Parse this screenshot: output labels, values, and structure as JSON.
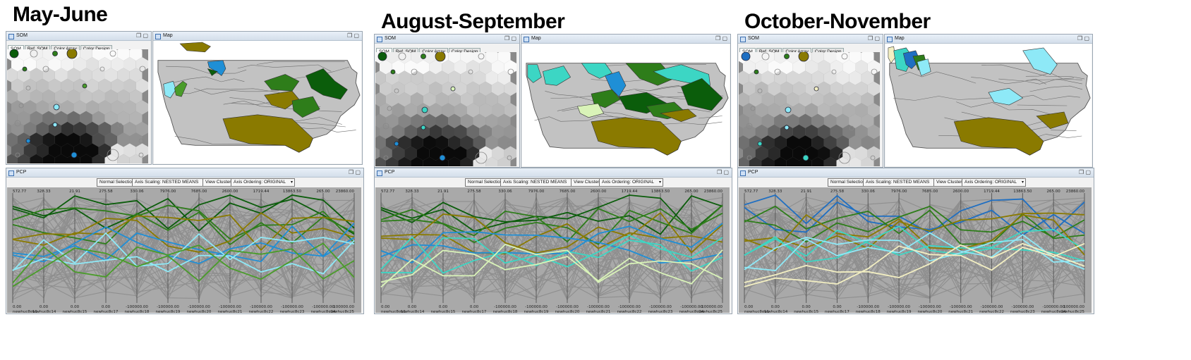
{
  "panels": [
    {
      "title": "May-June",
      "som_window": {
        "title": "SOM",
        "tabs": [
          "SOM",
          "Ref. SOM",
          "Color Array",
          "Color Design"
        ]
      },
      "map_window": {
        "title": "Map"
      },
      "pcp_window": {
        "title": "PCP",
        "controls": [
          "Normal Selection",
          "Axis Scaling: NESTED MEANS",
          "View Clusters",
          "Axis Ordering: ORIGINAL"
        ],
        "axis_labels": [
          "newhuc8c11",
          "newhuc8c14",
          "newhuc8c15",
          "newhuc8c17",
          "newhuc8c18",
          "newhuc8c19",
          "newhuc8c20",
          "newhuc8c21",
          "newhuc8c22",
          "newhuc8c23",
          "newhuc8c24",
          "newhuc8c25"
        ],
        "top_values": [
          "572.77",
          "328.33",
          "21.91",
          "275.58",
          "330.06",
          "7976.00",
          "7685.00",
          "2600.00",
          "1719.44",
          "13863.50",
          "265.00",
          "23860.00"
        ],
        "bottom_values": [
          "0.00",
          "0.00",
          "0.00",
          "0.00",
          "-100000.00",
          "-100000.00",
          "-100000.00",
          "-100000.00",
          "-100000.00",
          "-100000.00",
          "-100000.00",
          "-100000.00"
        ]
      }
    },
    {
      "title": "August-September",
      "som_window": {
        "title": "SOM",
        "tabs": [
          "SOM",
          "Ref. SOM",
          "Color Array",
          "Color Design"
        ]
      },
      "map_window": {
        "title": "Map"
      },
      "pcp_window": {
        "title": "PCP",
        "controls": [
          "Normal Selection",
          "Axis Scaling: NESTED MEANS",
          "View Clusters",
          "Axis Ordering: ORIGINAL"
        ],
        "axis_labels": [
          "newhuc8c11",
          "newhuc8c14",
          "newhuc8c15",
          "newhuc8c17",
          "newhuc8c18",
          "newhuc8c19",
          "newhuc8c20",
          "newhuc8c21",
          "newhuc8c22",
          "newhuc8c23",
          "newhuc8c24",
          "newhuc8c25"
        ],
        "top_values": [
          "572.77",
          "328.33",
          "21.91",
          "275.58",
          "330.06",
          "7976.00",
          "7685.00",
          "2600.00",
          "1719.44",
          "13863.50",
          "265.00",
          "23860.00"
        ],
        "bottom_values": [
          "0.00",
          "0.00",
          "0.00",
          "0.00",
          "-100000.00",
          "-100000.00",
          "-100000.00",
          "-100000.00",
          "-100000.00",
          "-100000.00",
          "-100000.00",
          "-100000.00"
        ]
      }
    },
    {
      "title": "October-November",
      "som_window": {
        "title": "SOM",
        "tabs": [
          "SOM",
          "Ref. SOM",
          "Color Array",
          "Color Design"
        ]
      },
      "map_window": {
        "title": "Map"
      },
      "pcp_window": {
        "title": "PCP",
        "controls": [
          "Normal Selection",
          "Axis Scaling: NESTED MEANS",
          "View Clusters",
          "Axis Ordering: ORIGINAL"
        ],
        "axis_labels": [
          "newhuc8c11",
          "newhuc8c14",
          "newhuc8c15",
          "newhuc8c17",
          "newhuc8c18",
          "newhuc8c19",
          "newhuc8c20",
          "newhuc8c21",
          "newhuc8c22",
          "newhuc8c23",
          "newhuc8c24",
          "newhuc8c25"
        ],
        "top_values": [
          "572.77",
          "328.33",
          "21.91",
          "275.58",
          "330.06",
          "7976.00",
          "7685.00",
          "2600.00",
          "1719.44",
          "13863.50",
          "265.00",
          "23860.00"
        ],
        "bottom_values": [
          "0.00",
          "0.00",
          "0.00",
          "0.00",
          "-100000.00",
          "-100000.00",
          "-100000.00",
          "-100000.00",
          "-100000.00",
          "-100000.00",
          "-100000.00",
          "-100000.00"
        ]
      }
    }
  ],
  "cluster_colors": {
    "p0": [
      "#0b5d0b",
      "#2e7d1a",
      "#8a7a00",
      "#1f8fd6",
      "#8ee9f7",
      "#4a9c2a"
    ],
    "p1": [
      "#0b5d0b",
      "#2e7d1a",
      "#8a7a00",
      "#1f8fd6",
      "#3cd6c4",
      "#d9f3b8"
    ],
    "p2": [
      "#1f6fc2",
      "#2e7d1a",
      "#8a7a00",
      "#3cd6c4",
      "#8ee9f7",
      "#f3efc2"
    ]
  },
  "icons": [
    "window-icon",
    "maximize-icon",
    "restore-icon",
    "dropdown-arrow-icon"
  ]
}
